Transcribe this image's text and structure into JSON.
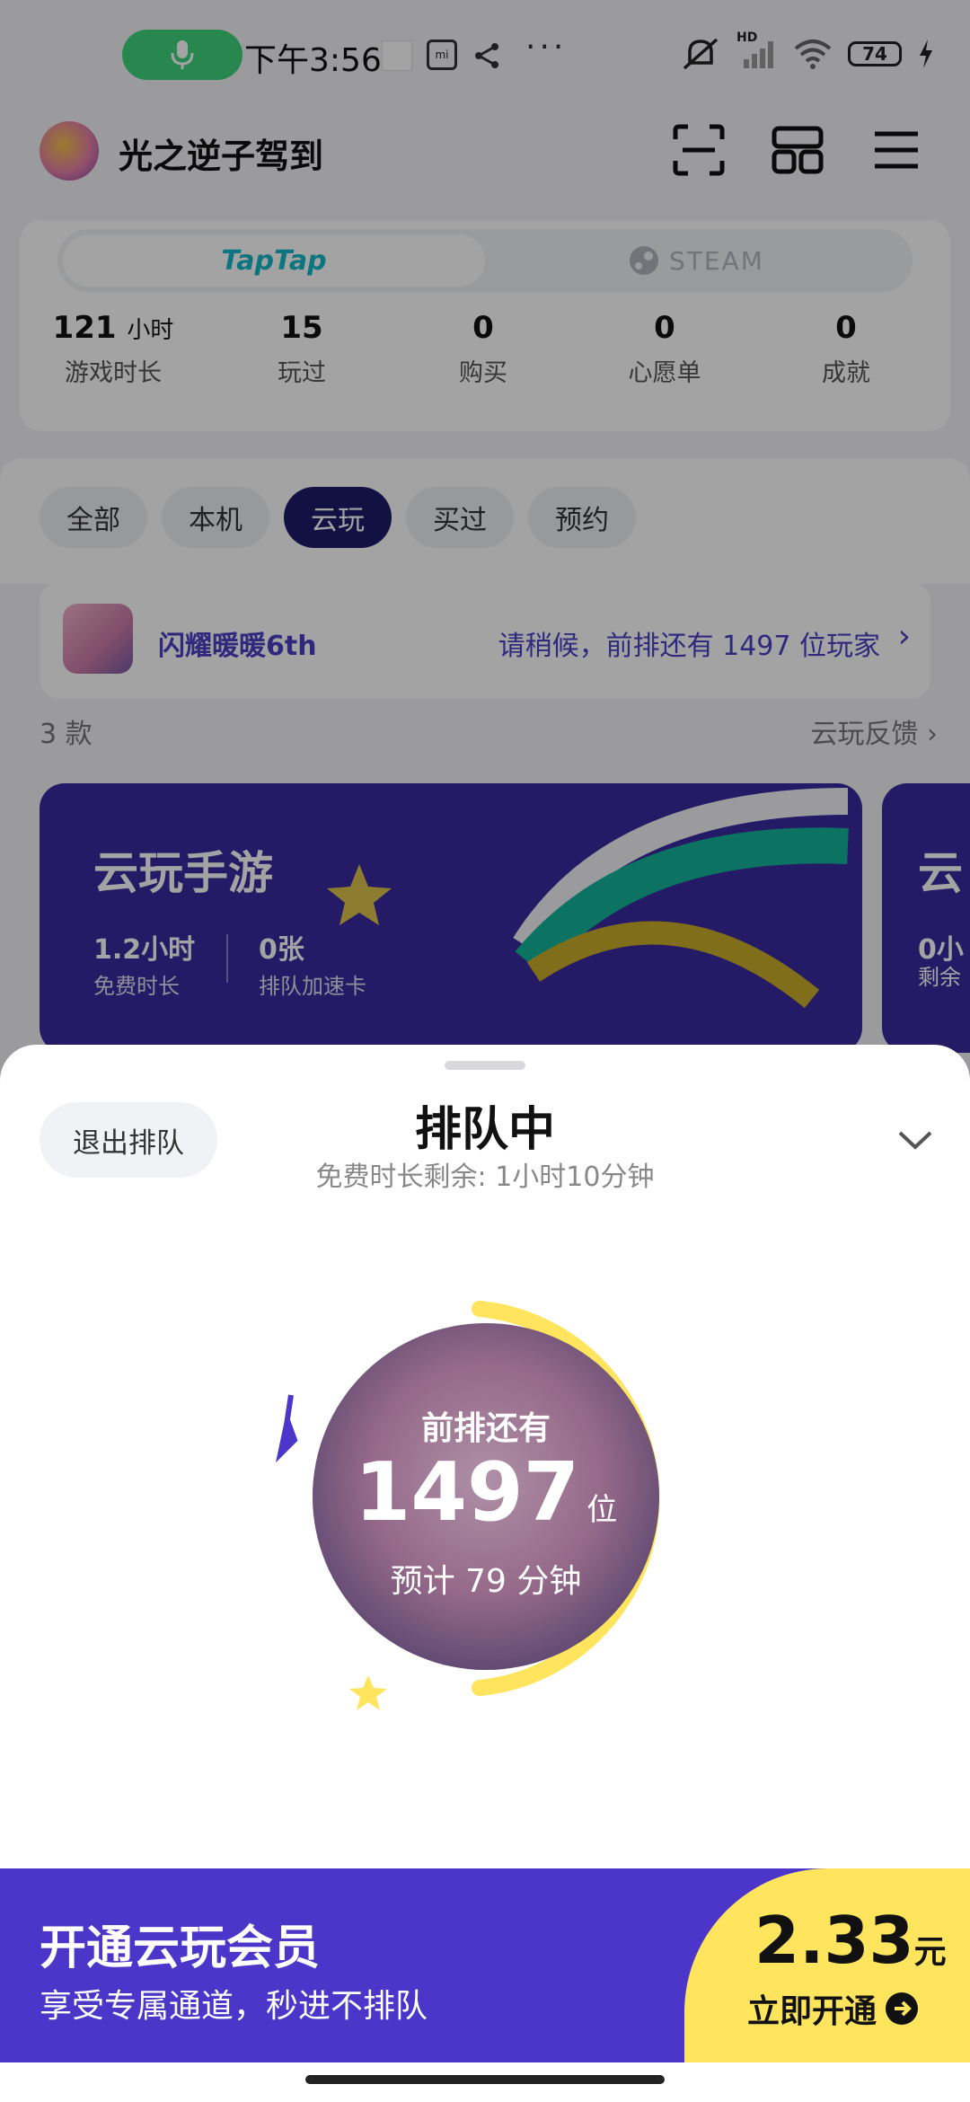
{
  "status_bar": {
    "time": "下午3:56",
    "mi_label": "mi",
    "battery": "74",
    "hd_label": "HD"
  },
  "header": {
    "username": "光之逆子驾到"
  },
  "platforms": {
    "taptap": "TapTap",
    "steam": "STEAM"
  },
  "stats": [
    {
      "value": "121",
      "unit": "小时",
      "label": "游戏时长"
    },
    {
      "value": "15",
      "unit": "",
      "label": "玩过"
    },
    {
      "value": "0",
      "unit": "",
      "label": "购买"
    },
    {
      "value": "0",
      "unit": "",
      "label": "心愿单"
    },
    {
      "value": "0",
      "unit": "",
      "label": "成就"
    }
  ],
  "filters": {
    "all": "全部",
    "local": "本机",
    "cloud": "云玩",
    "bought": "买过",
    "reserved": "预约",
    "selected": "云玩"
  },
  "queue_row": {
    "game": "闪耀暖暖6th",
    "message": "请稍候，前排还有 1497 位玩家"
  },
  "list_meta": {
    "count": "3 款",
    "feedback": "云玩反馈"
  },
  "promo_card": {
    "title": "云玩手游",
    "free_time_value": "1.2小时",
    "free_time_label": "免费时长",
    "cards_value": "0张",
    "cards_label": "排队加速卡",
    "peek_title": "云",
    "peek_value": "0小",
    "peek_label": "剩余"
  },
  "sheet": {
    "exit_button": "退出排队",
    "title": "排队中",
    "subtitle": "免费时长剩余: 1小时10分钟",
    "ahead_label": "前排还有",
    "queue_position": "1497",
    "queue_unit": "位",
    "eta": "预计 79 分钟"
  },
  "vip": {
    "title": "开通云玩会员",
    "subtitle": "享受专属通道，秒进不排队",
    "price": "2.33",
    "currency": "元",
    "cta": "立即开通"
  },
  "colors": {
    "accent": "#4b36c9",
    "active_chip": "#1f1c6b",
    "cta_yellow": "#ffe55e",
    "mic_green": "#3ed37c",
    "queue_link": "#4b3fc4"
  },
  "queue_progress": 0.5
}
